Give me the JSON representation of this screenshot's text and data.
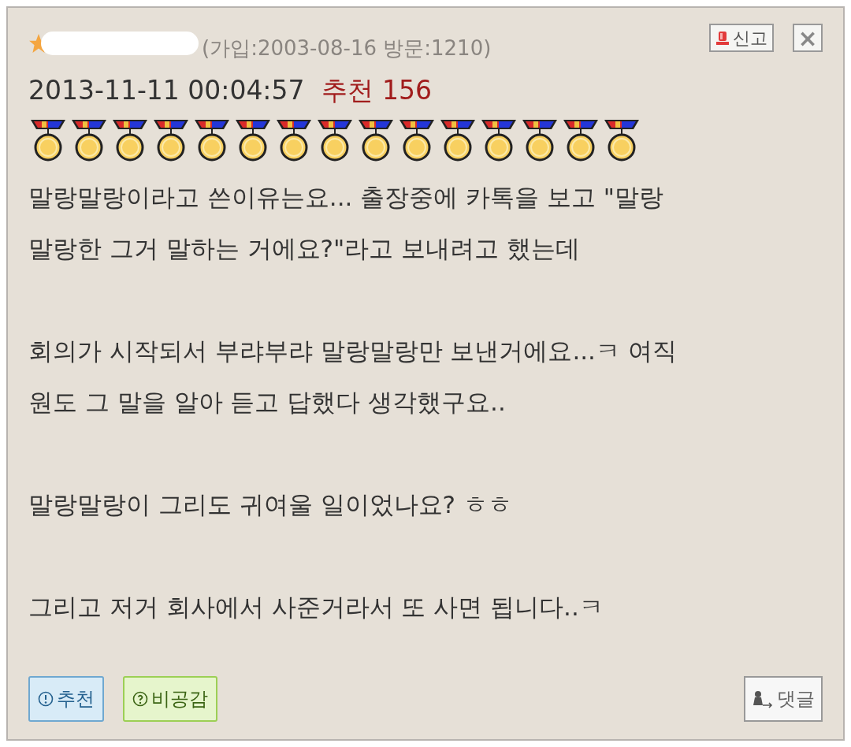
{
  "author": {
    "redacted": true,
    "joined_info": "(가입:2003-08-16 방문:1210)"
  },
  "report_button": {
    "label": "신고"
  },
  "close_button": {
    "label": "×"
  },
  "date": "2013-11-11 00:04:57",
  "recommend_count": "추천 156",
  "medals": [
    {
      "kind": "gold"
    },
    {
      "kind": "gold"
    },
    {
      "kind": "gold"
    },
    {
      "kind": "gold"
    },
    {
      "kind": "gold"
    },
    {
      "kind": "gold"
    },
    {
      "kind": "gold"
    },
    {
      "kind": "gold"
    },
    {
      "kind": "gold"
    },
    {
      "kind": "gold"
    },
    {
      "kind": "gold"
    },
    {
      "kind": "gold"
    },
    {
      "kind": "gold"
    },
    {
      "kind": "gold"
    },
    {
      "kind": "gold"
    }
  ],
  "paragraphs": [
    {
      "lines": [
        "말랑말랑이라고 쓴이유는요... 출장중에 카톡을 보고 \"말랑",
        "말랑한 그거 말하는 거에요?\"라고 보내려고 했는데"
      ]
    },
    {
      "lines": [
        "회의가 시작되서 부랴부랴 말랑말랑만 보낸거에요...ㅋ 여직",
        "원도 그 말을 알아 듣고 답했다 생각했구요.."
      ]
    },
    {
      "lines": [
        "말랑말랑이 그리도 귀여울 일이었나요? ㅎㅎ"
      ]
    },
    {
      "lines": [
        "그리고 저거 회사에서 사준거라서 또 사면 됩니다..ㅋ"
      ]
    }
  ],
  "actions": [
    {
      "kind": "recommend",
      "label": "추천"
    },
    {
      "kind": "disagree",
      "label": "비공감"
    }
  ],
  "reply_button": {
    "label": "댓글"
  }
}
